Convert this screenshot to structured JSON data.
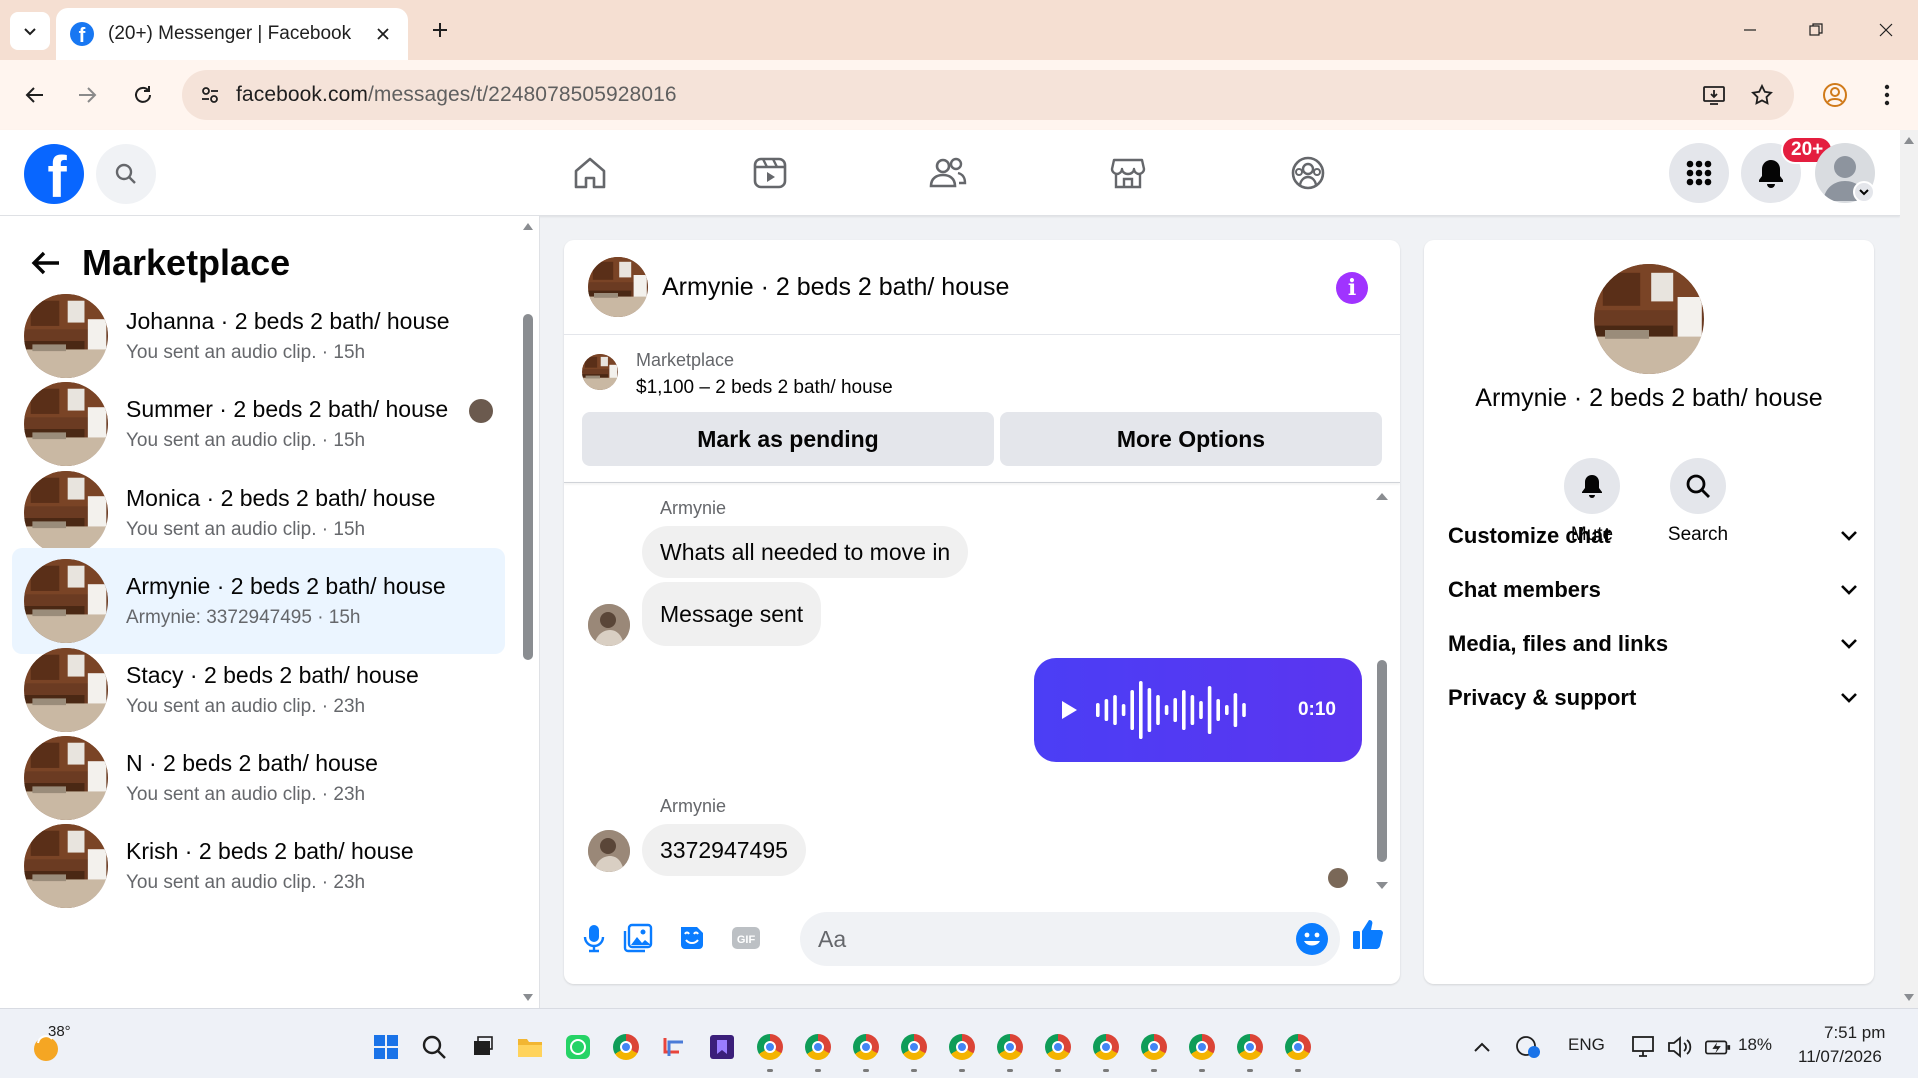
{
  "browser": {
    "tab_title": "(20+) Messenger | Facebook",
    "url_host": "facebook.com",
    "url_path": "/messages/t/2248078505928016"
  },
  "fb_header": {
    "notification_badge": "20+"
  },
  "left_panel": {
    "title": "Marketplace",
    "conversations": [
      {
        "name": "Johanna · 2 beds 2 bath/ house",
        "preview": "You sent an audio clip. · 15h",
        "active": false
      },
      {
        "name": "Summer · 2 beds 2 bath/ house",
        "preview": "You sent an audio clip. · 15h",
        "active": false
      },
      {
        "name": "Monica · 2 beds 2 bath/ house",
        "preview": "You sent an audio clip. · 15h",
        "active": false
      },
      {
        "name": "Armynie · 2 beds 2 bath/ house",
        "preview": "Armynie: 3372947495 · 15h",
        "active": true
      },
      {
        "name": "Stacy · 2 beds 2 bath/ house",
        "preview": "You sent an audio clip. · 23h",
        "active": false
      },
      {
        "name": "N · 2 beds 2 bath/ house",
        "preview": "You sent an audio clip. · 23h",
        "active": false
      },
      {
        "name": "Krish · 2 beds 2 bath/ house",
        "preview": "You sent an audio clip. · 23h",
        "active": false
      }
    ]
  },
  "chat": {
    "title": "Armynie · 2 beds 2 bath/ house",
    "marketplace_label": "Marketplace",
    "listing": "$1,100 – 2 beds 2 bath/ house",
    "mark_pending_label": "Mark as pending",
    "more_options_label": "More Options",
    "messages": {
      "sender_1": "Armynie",
      "msg_1": "Whats all needed to move in",
      "msg_2": "Message sent",
      "audio_duration": "0:10",
      "sender_2": "Armynie",
      "msg_3": "3372947495"
    },
    "composer_placeholder": "Aa"
  },
  "right_panel": {
    "name": "Armynie · 2 beds 2 bath/ house",
    "mute_label": "Mute",
    "search_label": "Search",
    "sections": [
      "Customize chat",
      "Chat members",
      "Media, files and links",
      "Privacy & support"
    ]
  },
  "taskbar": {
    "temperature": "38°",
    "language": "ENG",
    "battery": "18%",
    "time": "7:51 pm",
    "date": "11/07/2026"
  },
  "colors": {
    "fb_blue": "#0866ff",
    "messenger_purple": "#a033ff",
    "audio_bubble": "#4b3ef5",
    "active_conversation": "#ebf5ff",
    "badge_red": "#e41e3f"
  }
}
